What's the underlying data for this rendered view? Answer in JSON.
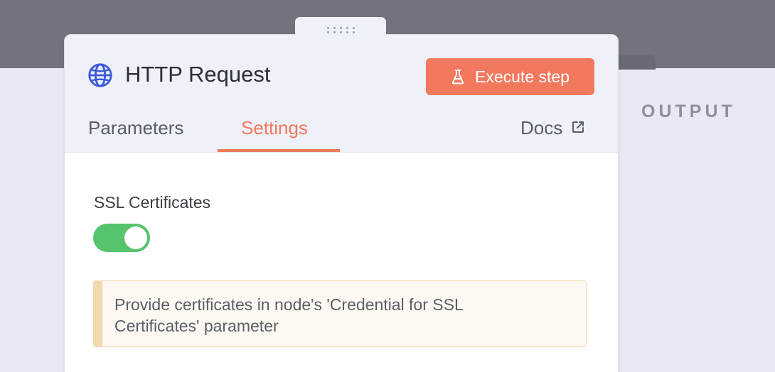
{
  "node": {
    "title": "HTTP Request",
    "execute_label": "Execute step",
    "icon": "globe-icon"
  },
  "tabs": [
    {
      "label": "Parameters",
      "active": false
    },
    {
      "label": "Settings",
      "active": true
    }
  ],
  "docs_label": "Docs",
  "output_label": "OUTPUT",
  "settings": {
    "ssl_label": "SSL Certificates",
    "ssl_enabled": true,
    "notice_text": "Provide certificates in node's 'Credential for SSL Certificates' parameter"
  },
  "colors": {
    "accent": "#f2795e",
    "toggle_on": "#56c46c",
    "notice_border": "#f1d9ad",
    "notice_bg": "#fdf8f1",
    "globe": "#3b5bdb"
  }
}
